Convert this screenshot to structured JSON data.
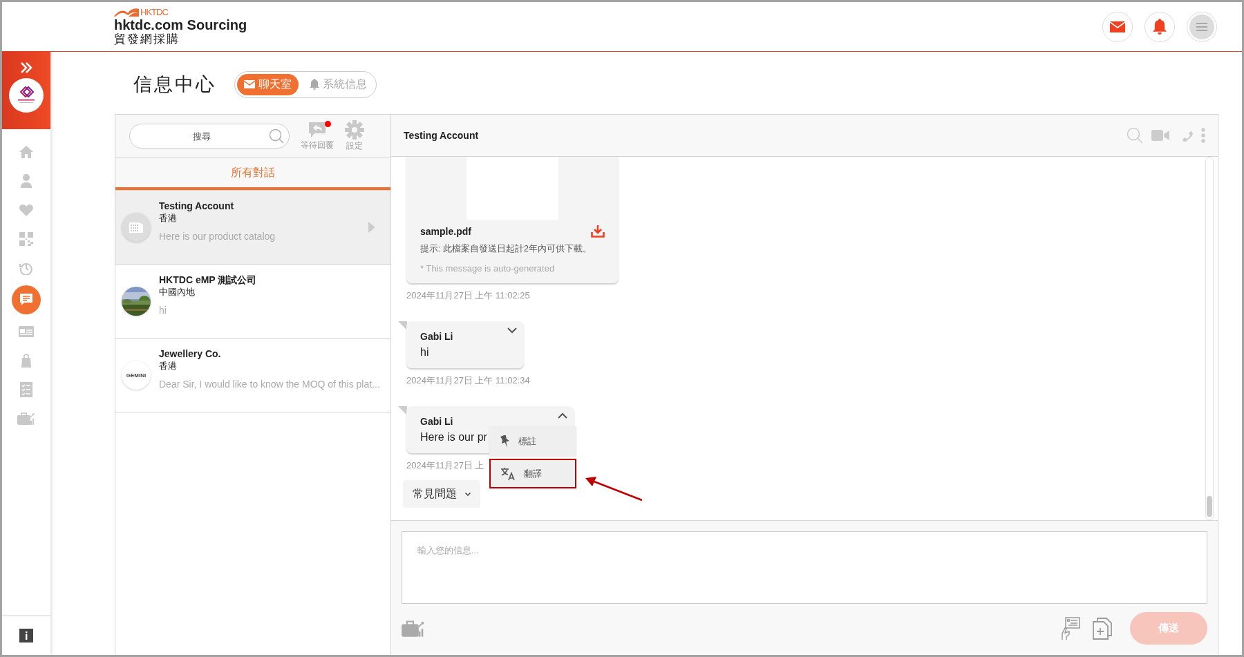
{
  "header": {
    "brand_mark": "HKTDC",
    "brand_name": "hktdc.com Sourcing",
    "brand_name_zh": "貿發網採購"
  },
  "page_title": "信息中心",
  "tabs": [
    {
      "label": "聊天室",
      "selected": true
    },
    {
      "label": "系統信息",
      "selected": false
    }
  ],
  "sidebar": {
    "items": [
      {
        "selected": false
      },
      {
        "selected": false
      },
      {
        "selected": false
      },
      {
        "selected": false
      },
      {
        "selected": false
      },
      {
        "selected": true
      },
      {
        "selected": false
      },
      {
        "selected": false
      },
      {
        "selected": false
      },
      {
        "selected": false
      }
    ]
  },
  "conversation_panel": {
    "search": {
      "placeholder": "搜尋"
    },
    "tools": [
      {
        "label": "等待回覆",
        "badge": true
      },
      {
        "label": "設定",
        "badge": false
      }
    ],
    "filter_tabs": [
      {
        "label": "所有對話",
        "selected": true
      }
    ],
    "conversations": [
      {
        "name": "Testing Account",
        "region": "香港",
        "preview": "Here is our product catalog",
        "selected": true
      },
      {
        "name": "HKTDC eMP 測試公司",
        "region": "中國內地",
        "preview": "hi",
        "selected": false
      },
      {
        "name": "Jewellery Co.",
        "region": "香港",
        "preview": "Dear Sir, I would like to know the MOQ of this plat...",
        "avatar_text": "GEMINI",
        "selected": false
      }
    ]
  },
  "chat": {
    "title": "Testing Account",
    "messages": [
      {
        "kind": "file",
        "file_name": "sample.pdf",
        "hint": "提示: 此檔案自發送日起計2年內可供下載。",
        "note": "* This message is auto-generated",
        "time": "2024年11月27日 上午 11:02:25"
      },
      {
        "kind": "text",
        "sender": "Gabi Li",
        "text": "hi",
        "expanded": false,
        "time": "2024年11月27日 上午 11:02:34"
      },
      {
        "kind": "text",
        "sender": "Gabi Li",
        "text": "Here is our pr",
        "expanded": true,
        "time": "2024年11月27日 上"
      }
    ],
    "message_menu": {
      "items": [
        {
          "label": "標註",
          "annotated": false
        },
        {
          "label": "翻譯",
          "annotated": true
        }
      ]
    },
    "faq_button": "常見問題",
    "composer": {
      "placeholder": "輸入您的信息...",
      "send_label": "傳送",
      "send_disabled": true
    }
  }
}
